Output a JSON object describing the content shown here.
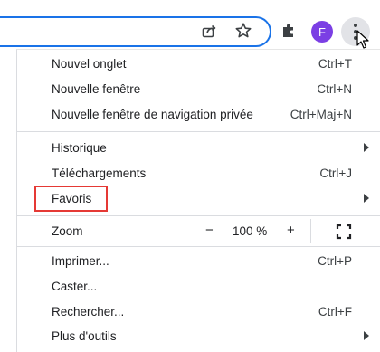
{
  "menu": {
    "group1": [
      {
        "label": "Nouvel onglet",
        "shortcut": "Ctrl+T"
      },
      {
        "label": "Nouvelle fenêtre",
        "shortcut": "Ctrl+N"
      },
      {
        "label": "Nouvelle fenêtre de navigation privée",
        "shortcut": "Ctrl+Maj+N"
      }
    ],
    "group2": [
      {
        "label": "Historique",
        "shortcut": ""
      },
      {
        "label": "Téléchargements",
        "shortcut": "Ctrl+J"
      },
      {
        "label": "Favoris",
        "shortcut": ""
      }
    ],
    "zoom": {
      "label": "Zoom",
      "minus": "−",
      "value": "100 %",
      "plus": "+"
    },
    "group3": [
      {
        "label": "Imprimer...",
        "shortcut": "Ctrl+P"
      },
      {
        "label": "Caster...",
        "shortcut": ""
      },
      {
        "label": "Rechercher...",
        "shortcut": "Ctrl+F"
      },
      {
        "label": "Plus d'outils",
        "shortcut": ""
      }
    ]
  },
  "profile": {
    "initial": "F"
  },
  "icons": [
    "share-icon",
    "star-icon",
    "extensions-icon",
    "kebab-menu-icon",
    "fullscreen-icon",
    "submenu-arrow-icon",
    "mouse-cursor-icon"
  ],
  "colors": {
    "accent": "#1a73e8",
    "avatar": "#7b3fe4",
    "highlight_box": "#e53935"
  }
}
